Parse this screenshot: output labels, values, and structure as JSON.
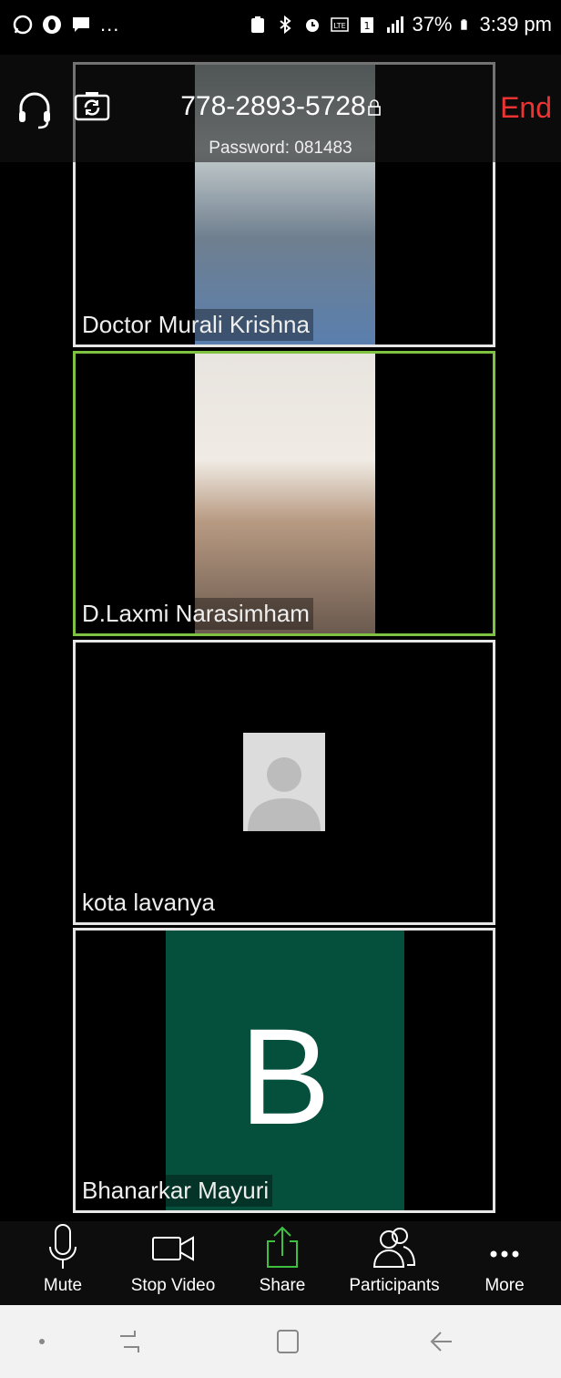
{
  "status_bar": {
    "battery": "37%",
    "time": "3:39 pm",
    "network": "LTE",
    "overflow": "..."
  },
  "meeting": {
    "id": "778-2893-5728",
    "password": "Password: 081483",
    "end_label": "End"
  },
  "participants": [
    {
      "name": "Doctor Murali Krishna",
      "video": "on",
      "active_speaker": false
    },
    {
      "name": "D.Laxmi Narasimham",
      "video": "on",
      "active_speaker": true
    },
    {
      "name": "kota lavanya",
      "video": "off",
      "avatar": "placeholder"
    },
    {
      "name": "Bhanarkar Mayuri",
      "video": "off",
      "avatar_letter": "B"
    }
  ],
  "toolbar": {
    "mute_label": "Mute",
    "stop_video_label": "Stop Video",
    "share_label": "Share",
    "participants_label": "Participants",
    "more_label": "More"
  },
  "colors": {
    "end": "#e33333",
    "active_border": "#7fc242",
    "share_icon": "#3fbf3f",
    "avatar_b_bg": "#05503d"
  },
  "icons": [
    "whatsapp-icon",
    "opera-icon",
    "message-icon",
    "battery-saver-icon",
    "bluetooth-icon",
    "alarm-icon",
    "volte-icon",
    "sim-icon",
    "signal-icon",
    "battery-icon",
    "headset-icon",
    "switch-camera-icon",
    "lock-icon",
    "microphone-icon",
    "video-camera-icon",
    "share-arrow-icon",
    "participants-icon",
    "more-icon"
  ]
}
